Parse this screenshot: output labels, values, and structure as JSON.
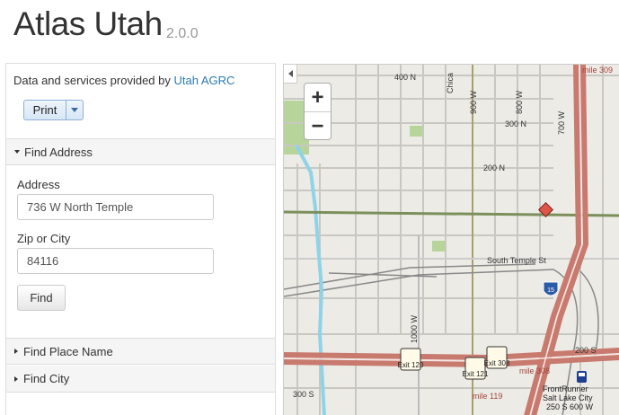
{
  "app": {
    "title": "Atlas Utah",
    "version": "2.0.0"
  },
  "sidebar": {
    "credit_prefix": "Data and services provided by ",
    "credit_link": "Utah AGRC",
    "print_label": "Print",
    "find_address": {
      "header": "Find Address",
      "address_label": "Address",
      "address_value": "736 W North Temple",
      "zip_label": "Zip or City",
      "zip_value": "84116",
      "find_label": "Find"
    },
    "find_place": {
      "header": "Find Place Name"
    },
    "find_city": {
      "header": "Find City"
    }
  },
  "map": {
    "zoom_in": "+",
    "zoom_out": "−",
    "labels": {
      "n400": "400 N",
      "n300": "300 N",
      "n200": "200 N",
      "south_temple": "South Temple St",
      "w900": "900 W",
      "w800": "800 W",
      "w700": "700 W",
      "w1000": "1000 W",
      "chicago": "Chica",
      "s200": "200 S",
      "s300": "300 S",
      "mile309": "mile 309",
      "mile308": "mile 308",
      "mile119": "mile 119",
      "exit120": "Exit 120",
      "exit121": "Exit 121",
      "exit308": "Exit 308",
      "i15": "15",
      "frontrunner1": "FrontRunner",
      "frontrunner2": "Salt Lake City",
      "frontrunner3": "250 S 600 W"
    },
    "colors": {
      "freeway": "#c87a6e",
      "railroad": "#888888",
      "river": "#8fd3e8",
      "rail_line": "#7b8f5b",
      "marker": "#e0554a",
      "park": "#b7d59a"
    },
    "icons": [
      "plus-icon",
      "minus-icon",
      "chevron-left-icon",
      "train-station-icon",
      "location-marker-icon",
      "interstate-shield-icon"
    ]
  }
}
